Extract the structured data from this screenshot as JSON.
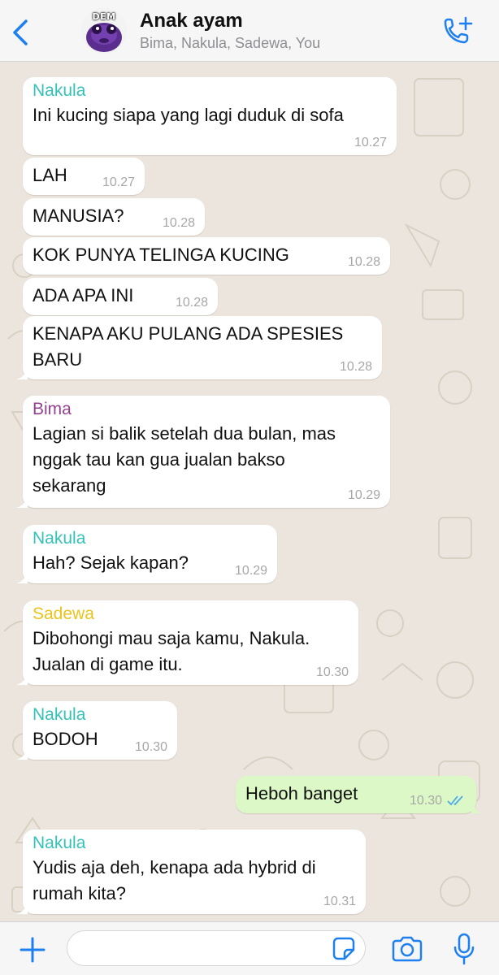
{
  "header": {
    "title": "Anak ayam",
    "participants": "Bima, Nakula, Sadewa, You",
    "avatar_text": "DEM",
    "back_icon": "chevron-left-icon",
    "call_icon": "add-call-icon"
  },
  "colors": {
    "accent": "#1e80f0",
    "nakula": "#35c2b7",
    "bima": "#95418f",
    "sadewa": "#eac31d",
    "outgoing_bubble": "#dcf8c6",
    "incoming_bubble": "#ffffff",
    "background": "#ece5dd"
  },
  "messages": [
    {
      "sender": "Nakula",
      "text": "Ini kucing siapa yang lagi duduk di sofa",
      "time": "10.27"
    },
    {
      "sender": "",
      "text": "LAH",
      "time": "10.27"
    },
    {
      "sender": "",
      "text": "MANUSIA?",
      "time": "10.28"
    },
    {
      "sender": "",
      "text": "KOK PUNYA TELINGA KUCING",
      "time": "10.28"
    },
    {
      "sender": "",
      "text": "ADA APA INI",
      "time": "10.28"
    },
    {
      "sender": "",
      "text": "KENAPA AKU PULANG ADA SPESIES\nBARU",
      "time": "10.28"
    },
    {
      "sender": "Bima",
      "text": "Lagian si balik setelah dua bulan, mas\nnggak tau kan gua jualan bakso\nsekarang",
      "time": "10.29"
    },
    {
      "sender": "Nakula",
      "text": "Hah? Sejak kapan?",
      "time": "10.29"
    },
    {
      "sender": "Sadewa",
      "text": "Dibohongi mau saja kamu, Nakula.\nJualan di game itu.",
      "time": "10.30"
    },
    {
      "sender": "Nakula",
      "text": "BODOH",
      "time": "10.30"
    },
    {
      "sender": "",
      "text": "Heboh banget",
      "time": "10.30",
      "outgoing": true,
      "status": "read-double-check-icon"
    },
    {
      "sender": "Nakula",
      "text": "Yudis aja deh, kenapa ada hybrid di\nrumah kita?",
      "time": "10.31"
    }
  ],
  "composer": {
    "value": "",
    "add_icon": "plus-icon",
    "sticker_icon": "sticker-icon",
    "camera_icon": "camera-icon",
    "mic_icon": "microphone-icon"
  }
}
